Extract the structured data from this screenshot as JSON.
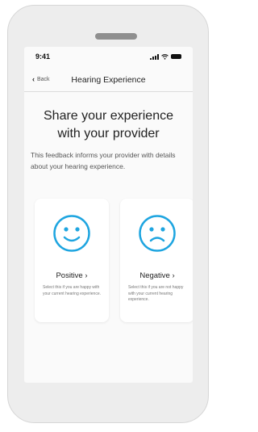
{
  "status_bar": {
    "time": "9:41"
  },
  "nav": {
    "back_label": "Back",
    "title": "Hearing Experience"
  },
  "main": {
    "headline_line1": "Share your experience",
    "headline_line2": "with your provider",
    "description": "This feedback informs your provider with details about your hearing experience."
  },
  "options": {
    "positive": {
      "label": "Positive ›",
      "description": "Select this if you are happy with your current hearing experience.",
      "icon": "smiley-happy-icon"
    },
    "negative": {
      "label": "Negative ›",
      "description": "Select this if you are not happy with your current hearing experience.",
      "icon": "smiley-sad-icon"
    }
  },
  "colors": {
    "accent": "#1ea5e0",
    "screen_bg": "#fafafa",
    "card_bg": "#ffffff",
    "device_frame": "#ededed"
  }
}
